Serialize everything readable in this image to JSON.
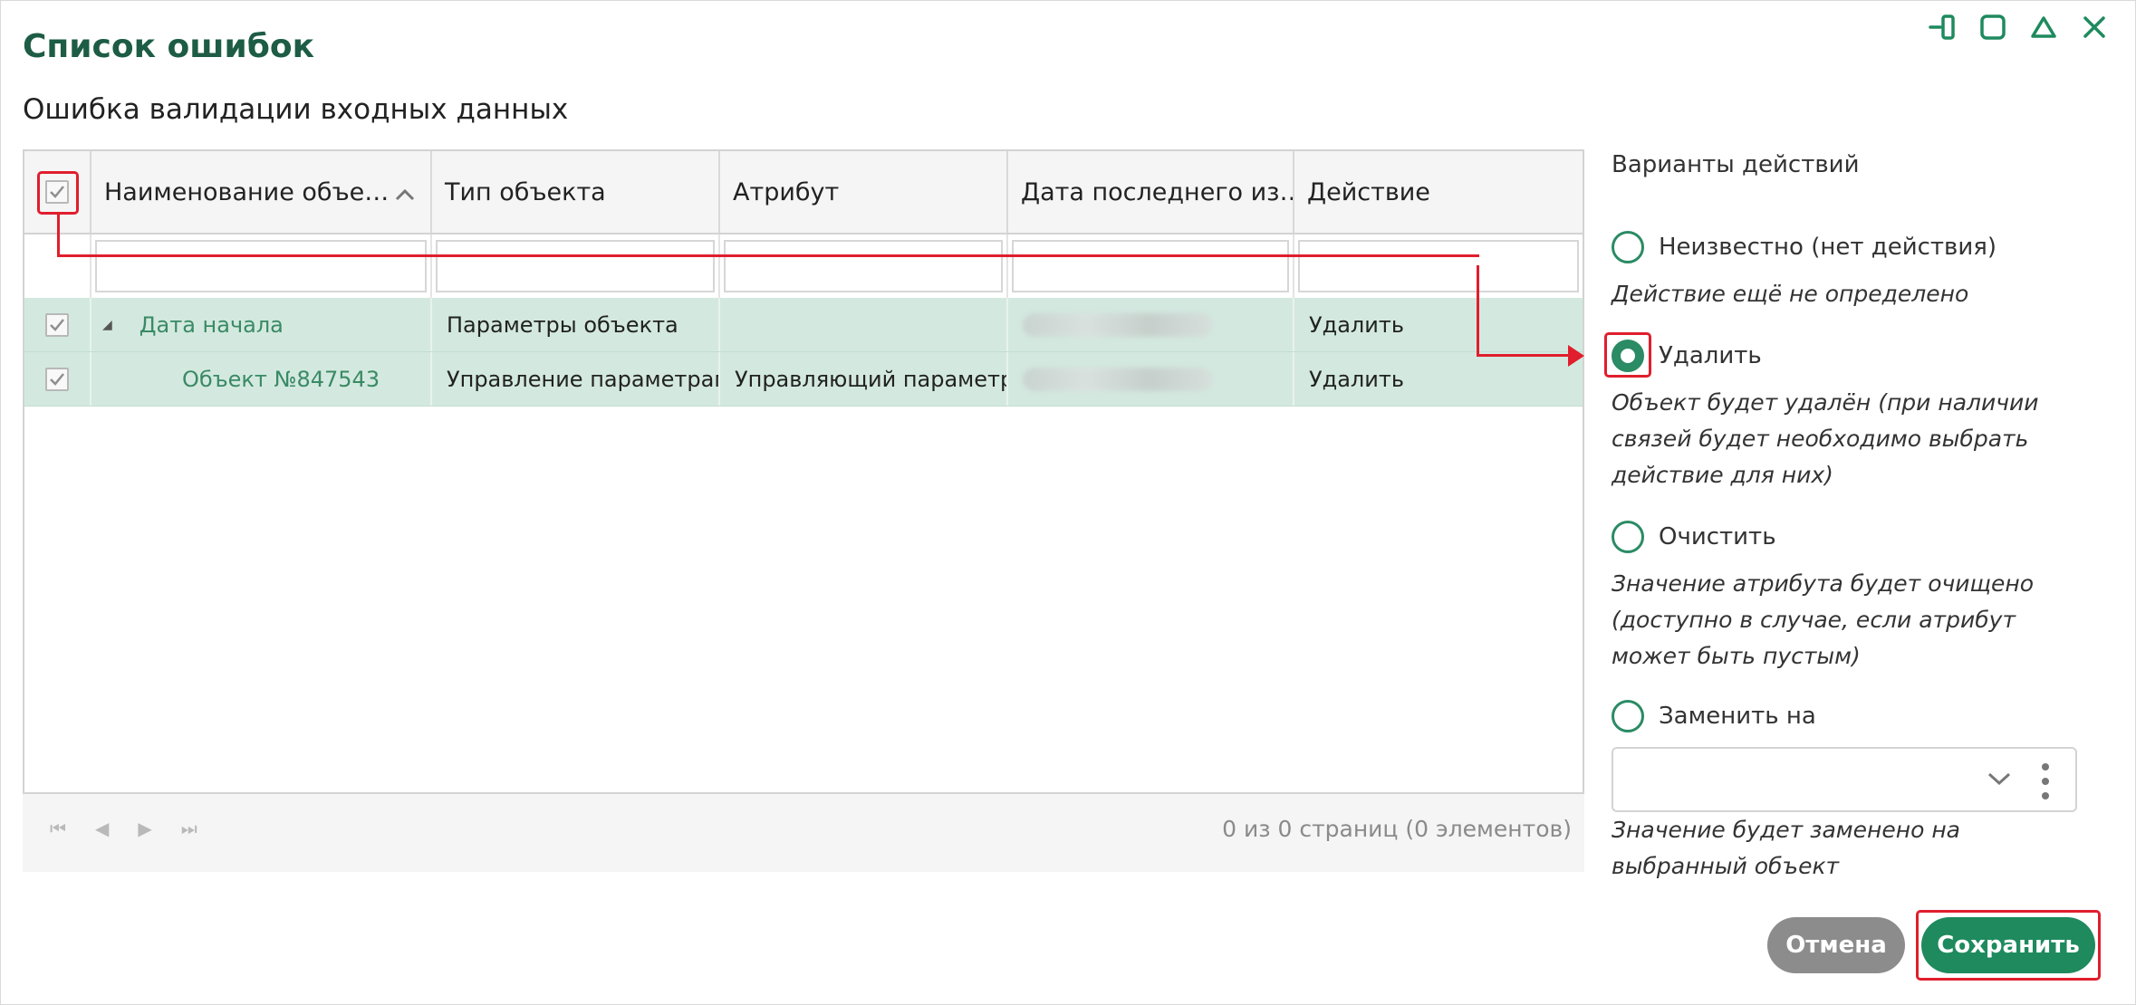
{
  "dialog": {
    "title": "Список ошибок",
    "subtitle": "Ошибка валидации входных данных"
  },
  "window_controls": [
    "dock-icon",
    "maximize-icon",
    "collapse-icon",
    "close-icon"
  ],
  "grid": {
    "columns": [
      "Наименование объе…",
      "Тип объекта",
      "Атрибут",
      "Дата последнего из…",
      "Действие"
    ],
    "rows": [
      {
        "name": "Дата начала",
        "type": "Параметры объекта",
        "attribute": "",
        "action": "Удалить",
        "checked": true
      },
      {
        "name": "Объект №847543",
        "type": "Управление параметрами",
        "attribute": "Управляющий параметр",
        "action": "Удалить",
        "checked": true
      }
    ]
  },
  "pager": {
    "info": "0 из 0 страниц (0 элементов)"
  },
  "actions_panel": {
    "title": "Варианты действий",
    "options": [
      {
        "label": "Неизвестно (нет действия)",
        "description": "Действие ещё не определено",
        "selected": false
      },
      {
        "label": "Удалить",
        "description": "Объект будет удалён (при наличии связей будет необходимо выбрать действие для них)",
        "selected": true
      },
      {
        "label": "Очистить",
        "description": "Значение атрибута будет очищено (доступно в случае, если атрибут может быть пустым)",
        "selected": false
      },
      {
        "label": "Заменить на",
        "description": "Значение будет заменено на выбранный объект",
        "selected": false
      }
    ],
    "replace_select_value": ""
  },
  "buttons": {
    "cancel": "Отмена",
    "save": "Сохранить"
  },
  "colors": {
    "accent": "#1e8a5e",
    "title": "#1d5c45",
    "row_selected": "#d3e9e0",
    "annotation": "#e01e2d"
  }
}
